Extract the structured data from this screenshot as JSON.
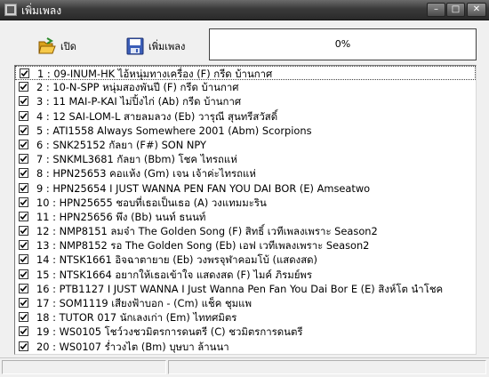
{
  "window": {
    "title": "เพิ่มเพลง"
  },
  "toolbar": {
    "open_label": "เปิด",
    "open_icon": "folder-open-icon",
    "add_label": "เพิ่มเพลง",
    "add_icon": "floppy-disk-icon"
  },
  "progress": {
    "text": "0%",
    "value": 0
  },
  "songs": [
    "1 : 09-INUM-HK ไอ้หนุ่มทางเครื่อง (F) กรีด บ้านกาศ",
    "2 : 10-N-SPP หนุ่มสองพันปี (F) กรีด บ้านกาศ",
    "3 : 11 MAI-P-KAI ไม่ปิ้งไก่ (Ab) กรีด บ้านกาศ",
    "4 : 12 SAI-LOM-L สายลมลวง (Eb) วารุณี สุนทรีสวัสดิ์",
    "5 : ATI1558 Always Somewhere 2001 (Abm) Scorpions",
    "6 : SNK25152 กัลยา (F#) SON NPY",
    "7 : SNKML3681 กัลยา  (Bbm) โชค ไทรถแห่",
    "8 : HPN25653 คอแห้ง  (Gm) เจน เจ้าค่ะไทรถแห่",
    "9 : HPN25654 I JUST WANNA PEN FAN YOU DAI BOR  (E) Amseatwo",
    "10 : HPN25655 ชอบที่เธอเป็นเธอ (A) วงแทมมะริน",
    "11 : HPN25656 พึง (Bb) นนท์ ธนนท์",
    "12 : NMP8151 ลมจ๋า The Golden Song (F) สิทธิ์ เวทีเพลงเพราะ Season2",
    "13 : NMP8152 รอ The Golden Song (Eb) เอฟ เวทีเพลงเพราะ Season2",
    "14 : NTSK1661 อิจฉาตายาย (Eb) วงพรจุฬาคอมโบ้ (แสดงสด)",
    "15 : NTSK1664 อยากให้เธอเข้าใจ แสดงสด (F) ไมค์ ภิรมย์พร",
    "16 : PTB1127 I JUST WANNA I Just Wanna Pen Fan You Dai Bor E (E) สิงห์โต นำโชค",
    "17 : SOM1119 เสียงฟ้าบอก - (Cm) แช็ค ชุมแพ",
    "18 : TUTOR 017 นักเลงเก่า (Em) ไททศมิตร",
    "19 : WS0105 โชว์วงชวมิตรการดนตรี (C) ชวมิตรการดนตรี",
    "20 : WS0107 ร่ำวงไต (Bm) บุษบา ล้านนา"
  ],
  "colors": {
    "titlebar": "#3a3a3a",
    "progress_fill": "#3b7bd4"
  }
}
